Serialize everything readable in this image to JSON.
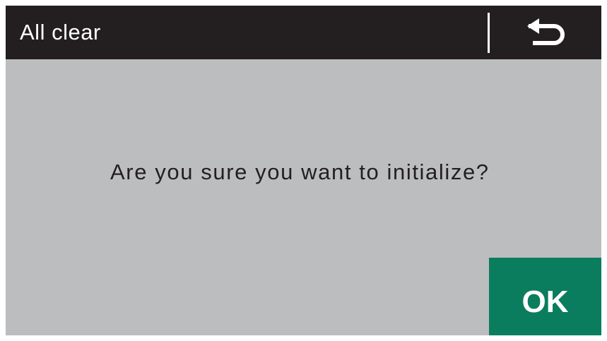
{
  "screen": {
    "title": "All clear",
    "back_icon": "return-arrow-icon"
  },
  "dialog": {
    "message": "Are you sure you want to initialize?",
    "ok_label": "OK"
  },
  "colors": {
    "title_bar": "#231f20",
    "background": "#bcbdbf",
    "ok_button": "#0a7d5e",
    "text": "#231f20"
  }
}
